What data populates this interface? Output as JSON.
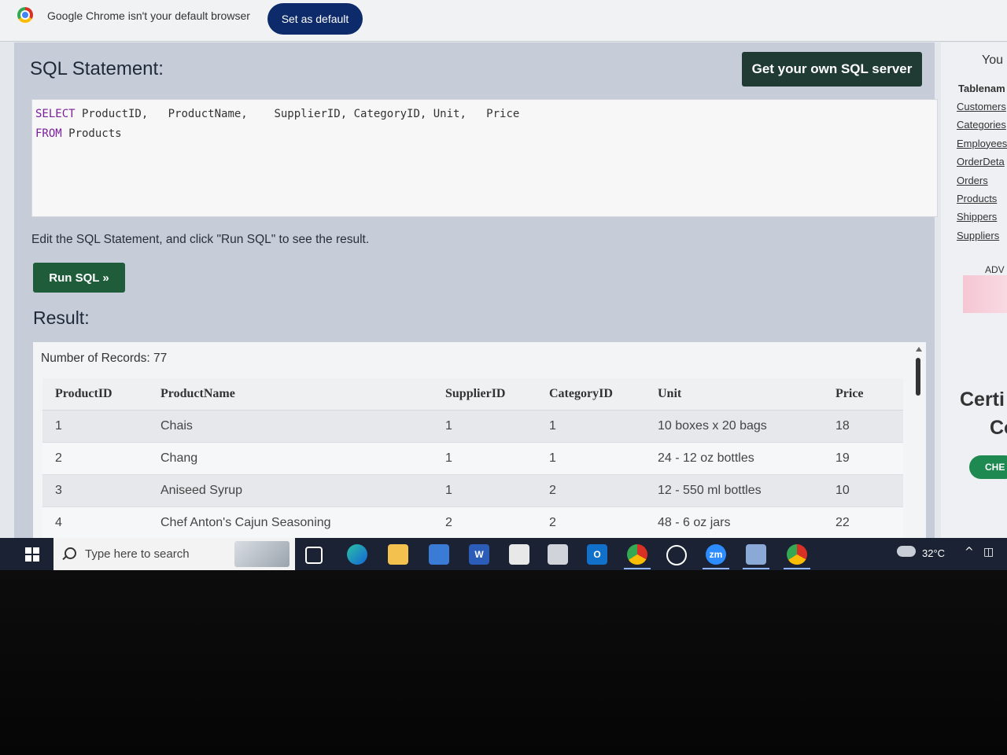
{
  "infobar": {
    "message": "Google Chrome isn't your default browser",
    "set_default_label": "Set as default"
  },
  "main": {
    "title": "SQL Statement:",
    "own_server_label": "Get your own SQL server",
    "sql": {
      "line1_kw": "SELECT",
      "line1_rest": " ProductID,   ProductName,    SupplierID, CategoryID, Unit,   Price",
      "line2_kw": "FROM",
      "line2_rest": " Products"
    },
    "edit_hint": "Edit the SQL Statement, and click \"Run SQL\" to see the result.",
    "run_label": "Run SQL »",
    "result_title": "Result:",
    "record_count": "Number of Records: 77",
    "columns": [
      "ProductID",
      "ProductName",
      "SupplierID",
      "CategoryID",
      "Unit",
      "Price"
    ],
    "rows": [
      [
        "1",
        "Chais",
        "1",
        "1",
        "10 boxes x 20 bags",
        "18"
      ],
      [
        "2",
        "Chang",
        "1",
        "1",
        "24 - 12 oz bottles",
        "19"
      ],
      [
        "3",
        "Aniseed Syrup",
        "1",
        "2",
        "12 - 550 ml bottles",
        "10"
      ],
      [
        "4",
        "Chef Anton's Cajun Seasoning",
        "2",
        "2",
        "48 - 6 oz jars",
        "22"
      ]
    ]
  },
  "sidebar": {
    "you_label": "You",
    "tablenames_label": "Tablenam",
    "tables": [
      "Customers",
      "Categories",
      "Employees",
      "OrderDeta",
      "Orders",
      "Products",
      "Shippers",
      "Suppliers"
    ],
    "adv_label": "ADV",
    "cert_label": "Certi",
    "cert_label2": "Co",
    "check_label": "CHE"
  },
  "taskbar": {
    "search_placeholder": "Type here to search",
    "temperature": "32°C",
    "icons": [
      "task-view-icon",
      "edge-icon",
      "file-explorer-icon",
      "mail-icon",
      "word-icon",
      "store-icon",
      "camera-icon",
      "outlook-icon",
      "chrome-icon",
      "whatsapp-icon",
      "zoom-icon",
      "network-app-icon",
      "chrome-alt-icon"
    ],
    "zoom_label": "zm",
    "word_label": "W",
    "outlook_label": "O"
  }
}
